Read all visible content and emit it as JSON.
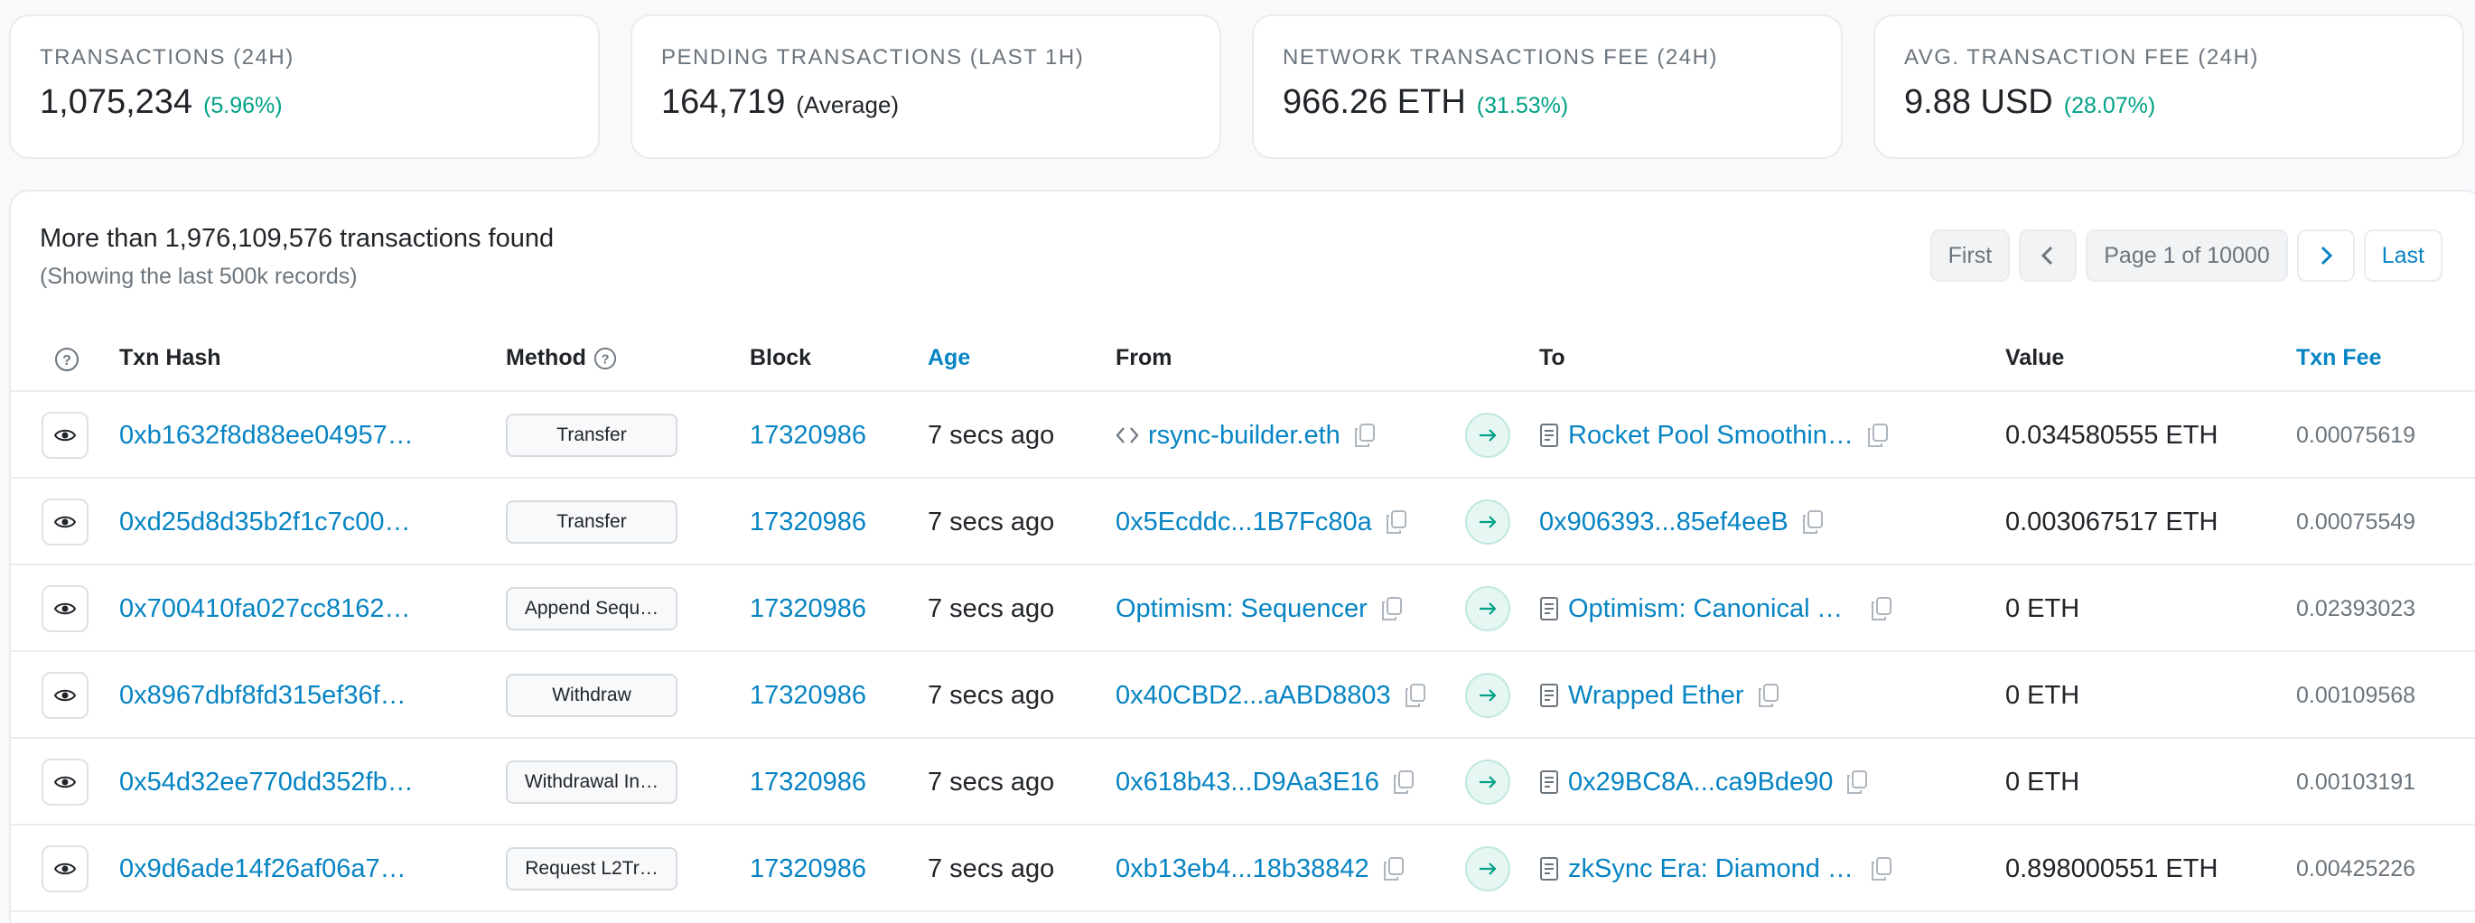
{
  "stats": [
    {
      "label": "TRANSACTIONS (24H)",
      "value": "1,075,234",
      "change": "(5.96%)",
      "note": ""
    },
    {
      "label": "PENDING TRANSACTIONS (LAST 1H)",
      "value": "164,719",
      "change": "",
      "note": "(Average)"
    },
    {
      "label": "NETWORK TRANSACTIONS FEE (24H)",
      "value": "966.26 ETH",
      "change": "(31.53%)",
      "note": ""
    },
    {
      "label": "AVG. TRANSACTION FEE (24H)",
      "value": "9.88 USD",
      "change": "(28.07%)",
      "note": ""
    }
  ],
  "summary": {
    "title": "More than 1,976,109,576 transactions found",
    "subtitle": "(Showing the last 500k records)"
  },
  "pager": {
    "first": "First",
    "page": "Page 1 of 10000",
    "last": "Last"
  },
  "columns": {
    "hash": "Txn Hash",
    "method": "Method",
    "block": "Block",
    "age": "Age",
    "from": "From",
    "to": "To",
    "value": "Value",
    "fee": "Txn Fee"
  },
  "rows": [
    {
      "hash": "0xb1632f8d88ee04957…",
      "method": "Transfer",
      "block": "17320986",
      "age": "7 secs ago",
      "from": "rsync-builder.eth",
      "to": "Rocket Pool Smoothin…",
      "value": "0.034580555 ETH",
      "fee": "0.00075619"
    },
    {
      "hash": "0xd25d8d35b2f1c7c00…",
      "method": "Transfer",
      "block": "17320986",
      "age": "7 secs ago",
      "from": "0x5Ecddc...1B7Fc80a",
      "to": "0x906393...85ef4eeB",
      "value": "0.003067517 ETH",
      "fee": "0.00075549"
    },
    {
      "hash": "0x700410fa027cc8162…",
      "method": "Append Sequ…",
      "block": "17320986",
      "age": "7 secs ago",
      "from": "Optimism: Sequencer",
      "to": "Optimism: Canonical Tr…",
      "value": "0 ETH",
      "fee": "0.02393023"
    },
    {
      "hash": "0x8967dbf8fd315ef36f…",
      "method": "Withdraw",
      "block": "17320986",
      "age": "7 secs ago",
      "from": "0x40CBD2...aABD8803",
      "to": "Wrapped Ether",
      "value": "0 ETH",
      "fee": "0.00109568"
    },
    {
      "hash": "0x54d32ee770dd352fb…",
      "method": "Withdrawal In…",
      "block": "17320986",
      "age": "7 secs ago",
      "from": "0x618b43...D9Aa3E16",
      "to": "0x29BC8A...ca9Bde90",
      "value": "0 ETH",
      "fee": "0.00103191"
    },
    {
      "hash": "0x9d6ade14f26af06a7…",
      "method": "Request L2Tr…",
      "block": "17320986",
      "age": "7 secs ago",
      "from": "0xb13eb4...18b38842",
      "to": "zkSync Era: Diamond P…",
      "value": "0.898000551 ETH",
      "fee": "0.00425226"
    }
  ],
  "colors": {
    "link": "#0784c3",
    "positive": "#00a186",
    "muted": "#6c757d"
  }
}
